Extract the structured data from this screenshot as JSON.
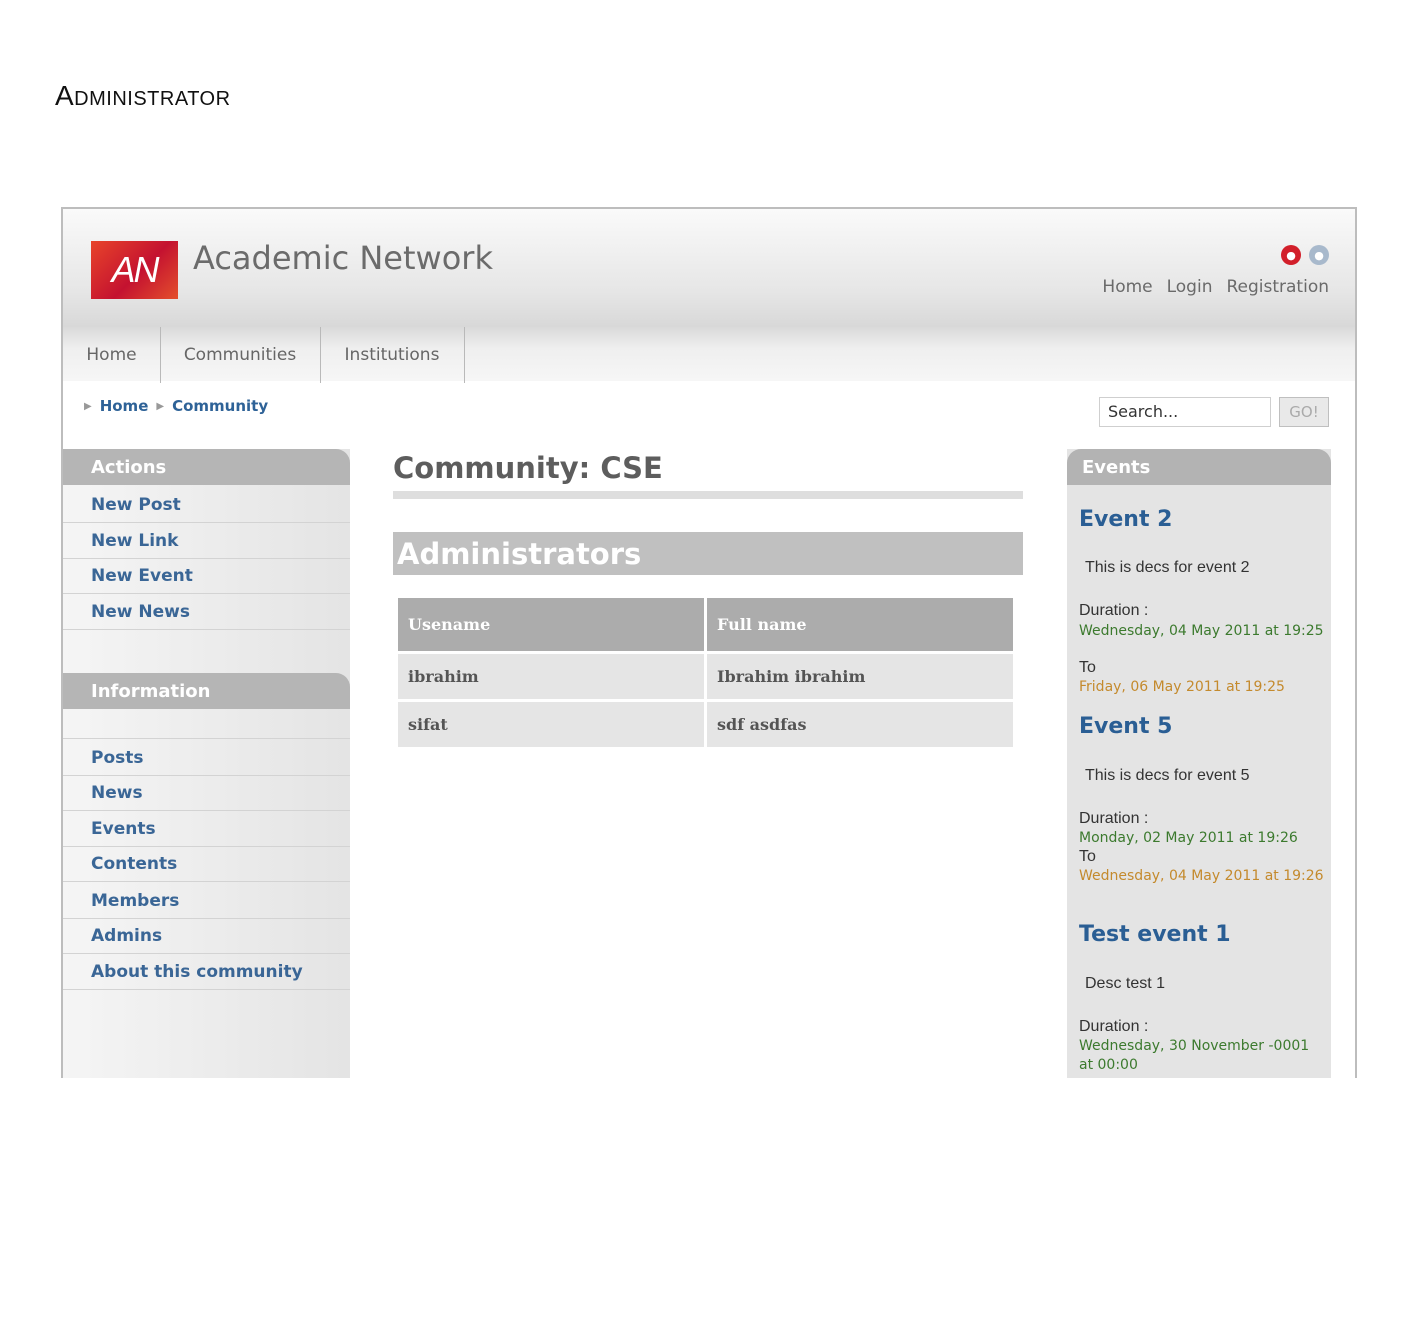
{
  "document": {
    "heading": "Administrator"
  },
  "header": {
    "logo_text": "AN",
    "site_title": "Academic Network",
    "top_links": [
      "Home",
      "Login",
      "Registration"
    ]
  },
  "nav": {
    "items": [
      "Home",
      "Communities",
      "Institutions"
    ]
  },
  "breadcrumb": [
    "Home",
    "Community"
  ],
  "search": {
    "value": "Search...",
    "button": "GO!"
  },
  "sidebar": {
    "actions_header": "Actions",
    "actions": [
      "New Post",
      "New Link",
      "New Event",
      "New News"
    ],
    "information_header": "Information",
    "information": [
      "Posts",
      "News",
      "Events",
      "Contents",
      "Members",
      "Admins",
      "About this community"
    ]
  },
  "main": {
    "title": "Community: CSE",
    "section": "Administrators",
    "columns": [
      "Usename",
      "Full name"
    ],
    "rows": [
      [
        "ibrahim",
        "Ibrahim ibrahim"
      ],
      [
        "sifat",
        "sdf asdfas"
      ]
    ]
  },
  "events": {
    "header": "Events",
    "duration_label": "Duration :",
    "to_label": "To",
    "items": [
      {
        "title": "Event 2",
        "desc": "This is decs for event 2",
        "start": "Wednesday, 04 May 2011 at 19:25",
        "end": "Friday, 06 May 2011 at 19:25"
      },
      {
        "title": "Event 5",
        "desc": "This is decs for event 5",
        "start": "Monday, 02 May 2011 at 19:26",
        "end": "Wednesday, 04 May 2011 at 19:26"
      },
      {
        "title": "Test event 1",
        "desc": "Desc test 1",
        "start": "Wednesday, 30 November -0001 at 00:00"
      }
    ]
  },
  "icons": {
    "language_flags": [
      "red-flag-icon",
      "blue-flag-icon"
    ]
  },
  "colors": {
    "link_blue": "#3a6696",
    "event_green": "#3c7a2e",
    "event_orange": "#c48a2d",
    "panel_gray": "#b5b5b5"
  }
}
